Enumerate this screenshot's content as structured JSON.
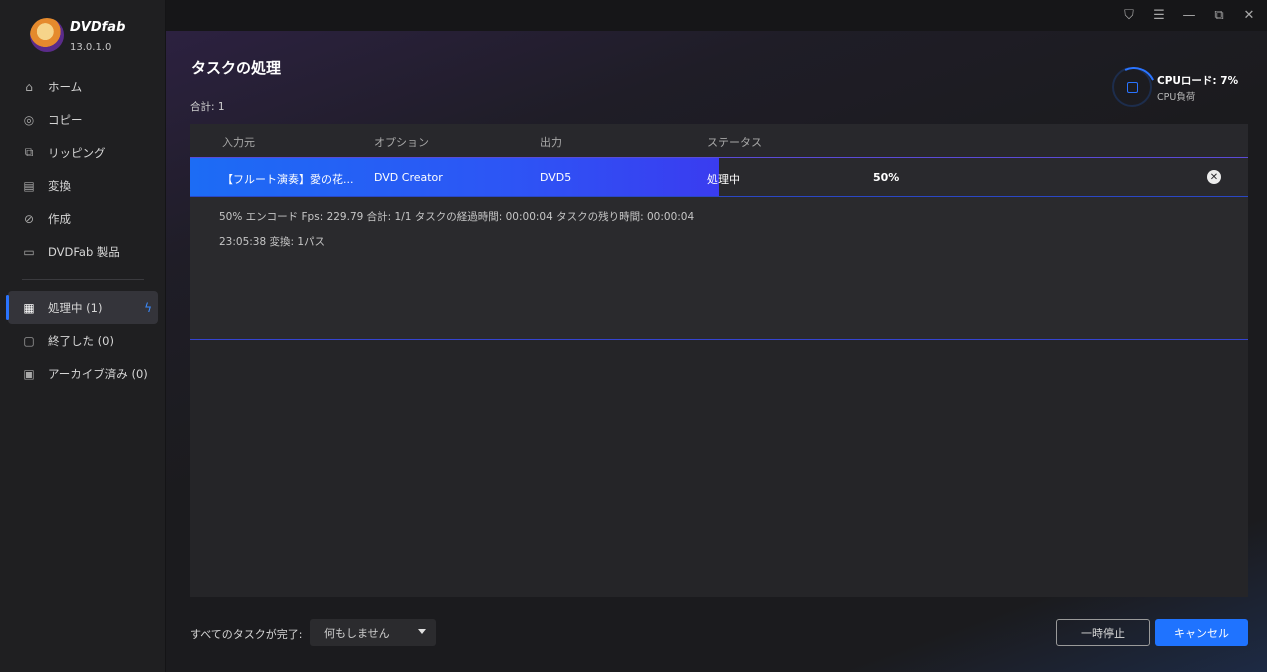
{
  "app": {
    "brand": "DVDfab",
    "version": "13.0.1.0"
  },
  "sidebar": {
    "items": [
      {
        "label": "ホーム",
        "icon": "home-icon"
      },
      {
        "label": "コピー",
        "icon": "copy-icon"
      },
      {
        "label": "リッピング",
        "icon": "ripping-icon"
      },
      {
        "label": "変換",
        "icon": "film-icon"
      },
      {
        "label": "作成",
        "icon": "disc-icon"
      },
      {
        "label": "DVDFab 製品",
        "icon": "box-icon"
      }
    ],
    "queue": [
      {
        "label": "処理中 (1)",
        "icon": "processing-icon",
        "active": true
      },
      {
        "label": "終了した (0)",
        "icon": "clipboard-icon"
      },
      {
        "label": "アーカイブ済み (0)",
        "icon": "archive-icon"
      }
    ]
  },
  "main": {
    "title": "タスクの処理",
    "total": "合計: 1",
    "cpu": {
      "label": "CPUロード: 7%",
      "sub": "CPU負荷"
    },
    "table": {
      "columns": [
        "入力元",
        "オプション",
        "出力",
        "ステータス"
      ],
      "rows": [
        {
          "source": "【フルート演奏】愛の花...",
          "option": "DVD Creator",
          "output": "DVD5",
          "status": "処理中",
          "percent": "50%",
          "progress": 0.5
        }
      ],
      "details": [
        "50%  エンコード Fps: 229.79  合計: 1/1  タスクの経過時間: 00:00:04  タスクの残り時間: 00:00:04",
        "23:05:38  変換: 1パス"
      ]
    }
  },
  "footer": {
    "after_label": "すべてのタスクが完了:",
    "after_value": "何もしません",
    "pause": "一時停止",
    "cancel": "キャンセル"
  },
  "colors": {
    "accent": "#1f73ff",
    "progress": "#2d55f5"
  }
}
